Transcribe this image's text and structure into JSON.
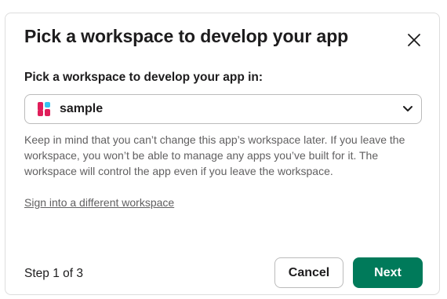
{
  "dialog": {
    "title": "Pick a workspace to develop your app",
    "close_icon": "close-icon"
  },
  "workspace_select": {
    "label": "Pick a workspace to develop your app in:",
    "selected_value": "sample",
    "logo_icon": "workspace-logo-icon",
    "logo_colors": [
      "#e01e5a",
      "#36c5f0"
    ],
    "dropdown_icon": "chevron-down-icon"
  },
  "help_text": "Keep in mind that you can’t change this app’s workspace later. If you leave the workspace, you won’t be able to manage any apps you’ve built for it. The workspace will control the app even if you leave the workspace.",
  "alt_link": "Sign into a different workspace",
  "footer": {
    "step_text": "Step 1 of 3",
    "cancel_label": "Cancel",
    "next_label": "Next",
    "next_color": "#007a5a"
  }
}
